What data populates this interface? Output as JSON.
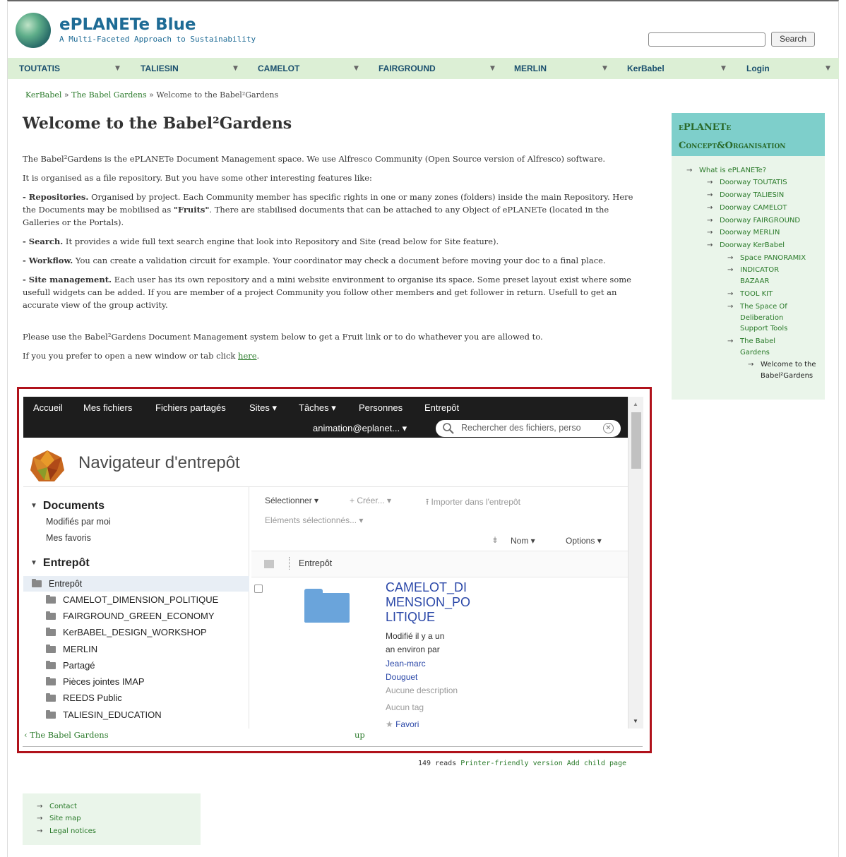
{
  "site": {
    "name": "ePLANETe Blue",
    "slogan": "A Multi-Faceted Approach to Sustainability",
    "search_button": "Search"
  },
  "nav": [
    {
      "label": "TOUTATIS"
    },
    {
      "label": "TALIESIN"
    },
    {
      "label": "CAMELOT"
    },
    {
      "label": "FAIRGROUND"
    },
    {
      "label": "MERLIN"
    },
    {
      "label": "KerBabel"
    },
    {
      "label": "Login"
    }
  ],
  "breadcrumb": {
    "items": [
      "KerBabel",
      "The Babel Gardens",
      "Welcome to the Babel²Gardens"
    ],
    "separator": "»"
  },
  "page_title": "Welcome to the Babel²Gardens",
  "content": {
    "p1": "The Babel²Gardens is the ePLANETe Document Management space. We use Alfresco Community (Open Source version of Alfresco) software.",
    "p2": "It is organised as a file repository. But you have some other interesting features like:",
    "p3_bold": "- Repositories.",
    "p3_a": " Organised by project. Each Community member has specific rights in one or many zones (folders) inside the main Repository. Here the Documents may be mobilised as ",
    "p3_fruits": "\"Fruits\"",
    "p3_b": ". There are stabilised documents that can be attached to any Object of ePLANETe (located in the Galleries or the Portals).",
    "p4_bold": "- Search.",
    "p4": " It provides a wide full text search engine that look into Repository and Site (read below for Site feature).",
    "p5_bold": "- Workflow.",
    "p5": " You can create a validation circuit for example. Your coordinator may check a document before moving your doc to a final place.",
    "p6_bold": "- Site management.",
    "p6": " Each user has its own repository and a mini website environment to organise its space. Some preset layout exist where some usefull widgets can be added. If you are member of a project Community you follow other members and get follower in return. Usefull to get an accurate view of the group activity.",
    "p7": "Please use the Babel²Gardens Document Management system below to get a Fruit link or to do whathever you are allowed to.",
    "p8_a": "If you you prefer to open a new window or tab click ",
    "p8_link": "here",
    "p8_b": "."
  },
  "share": {
    "nav": [
      "Accueil",
      "Mes fichiers",
      "Fichiers partagés",
      "Sites ▾",
      "Tâches ▾",
      "Personnes",
      "Entrepôt"
    ],
    "user": "animation@eplanet... ▾",
    "search_placeholder": "Rechercher des fichiers, perso",
    "title": "Navigateur d'entrepôt",
    "left": {
      "documents": "Documents",
      "modified_by_me": "Modifiés par moi",
      "favorites": "Mes favoris",
      "repository": "Entrepôt",
      "root": "Entrepôt",
      "folders": [
        "CAMELOT_DIMENSION_POLITIQUE",
        "FAIRGROUND_GREEN_ECONOMY",
        "KerBABEL_DESIGN_WORKSHOP",
        "MERLIN",
        "Partagé",
        "Pièces jointes IMAP",
        "REEDS Public",
        "TALIESIN_EDUCATION"
      ]
    },
    "toolbar": {
      "select": "Sélectionner ▾",
      "create": "+ Créer... ▾",
      "import": "Importer dans l'entrepôt",
      "selected": "Eléments sélectionnés... ▾",
      "sort": "Nom ▾",
      "options": "Options ▾"
    },
    "path": "Entrepôt",
    "item": {
      "name": "CAMELOT_DIMENSION_POLITIQUE",
      "modified_1": "Modifié il y a un",
      "modified_2": "an environ par",
      "author_1": "Jean-marc",
      "author_2": "Douguet",
      "description": "Aucune description",
      "tags": "Aucun tag",
      "favorite": "Favori"
    }
  },
  "book_nav": {
    "prev": "‹ The Babel Gardens",
    "up": "up"
  },
  "links": {
    "reads": "149 reads",
    "printer": "Printer-friendly version",
    "add_child": "Add child page"
  },
  "sidebar": {
    "title_1": "ePLANETe",
    "title_2": "Concept&Organisation",
    "items": [
      {
        "label": "What is ePLANETe?"
      },
      {
        "label": "Doorway TOUTATIS"
      },
      {
        "label": "Doorway TALIESIN"
      },
      {
        "label": "Doorway CAMELOT"
      },
      {
        "label": "Doorway FAIRGROUND"
      },
      {
        "label": "Doorway MERLIN"
      },
      {
        "label": "Doorway KerBabel"
      },
      {
        "label": "Space PANORAMIX"
      },
      {
        "label": "INDICATOR BAZAAR"
      },
      {
        "label": "TOOL KIT"
      },
      {
        "label": "The Space Of Deliberation Support Tools"
      },
      {
        "label": "The Babel Gardens"
      },
      {
        "label": "Welcome to the Babel²Gardens"
      }
    ]
  },
  "footer": {
    "items": [
      "Contact",
      "Site map",
      "Legal notices"
    ]
  }
}
